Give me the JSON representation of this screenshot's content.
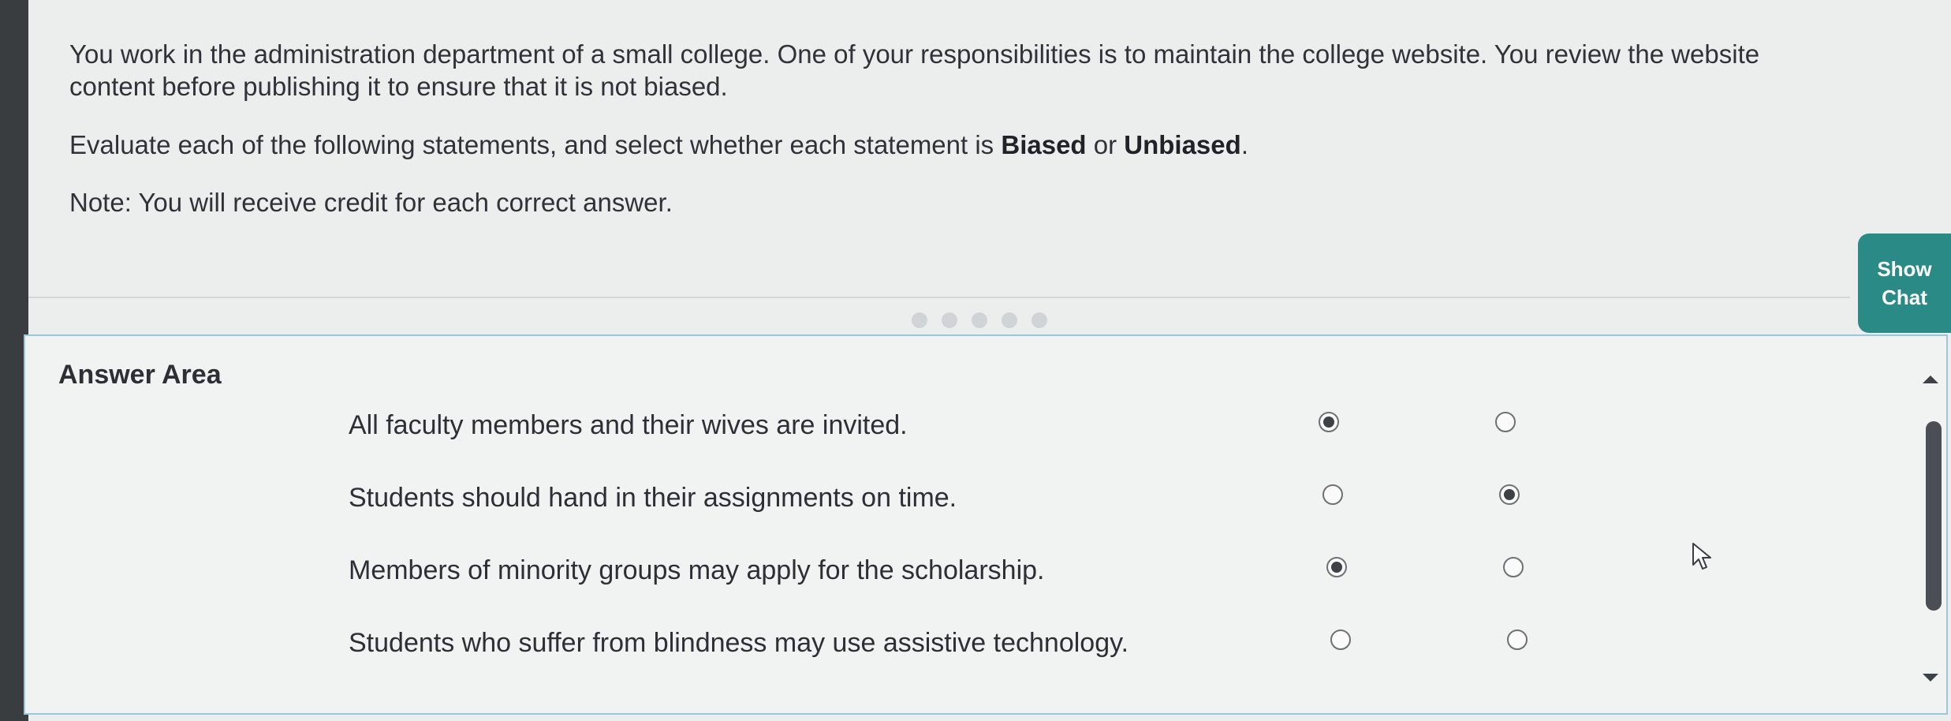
{
  "question": {
    "paragraph1": "You work in the administration department of a small college. One of your responsibilities is to maintain the college website. You review the website content before publishing it to ensure that it is not biased.",
    "instruction_prefix": "Evaluate each of the following statements, and select whether each statement is ",
    "option_biased": "Biased",
    "instruction_or": " or ",
    "option_unbiased": "Unbiased",
    "instruction_suffix": ".",
    "note": "Note: You will receive credit for each correct answer."
  },
  "chat_button": {
    "line1": "Show",
    "line2": "Chat"
  },
  "pager": {
    "dots": 5
  },
  "answer_area": {
    "title": "Answer Area",
    "statements": [
      {
        "text": "All faculty members and their wives are invited.",
        "selected": "biased"
      },
      {
        "text": "Students should hand in their assignments on time.",
        "selected": "unbiased"
      },
      {
        "text": "Members of minority groups may apply for the scholarship.",
        "selected": "biased"
      },
      {
        "text": "Students who suffer from blindness may use assistive technology.",
        "selected": "none"
      }
    ]
  },
  "colors": {
    "accent": "#2a8a86",
    "answer_border": "#9ec6d6",
    "text": "#2c3034"
  }
}
